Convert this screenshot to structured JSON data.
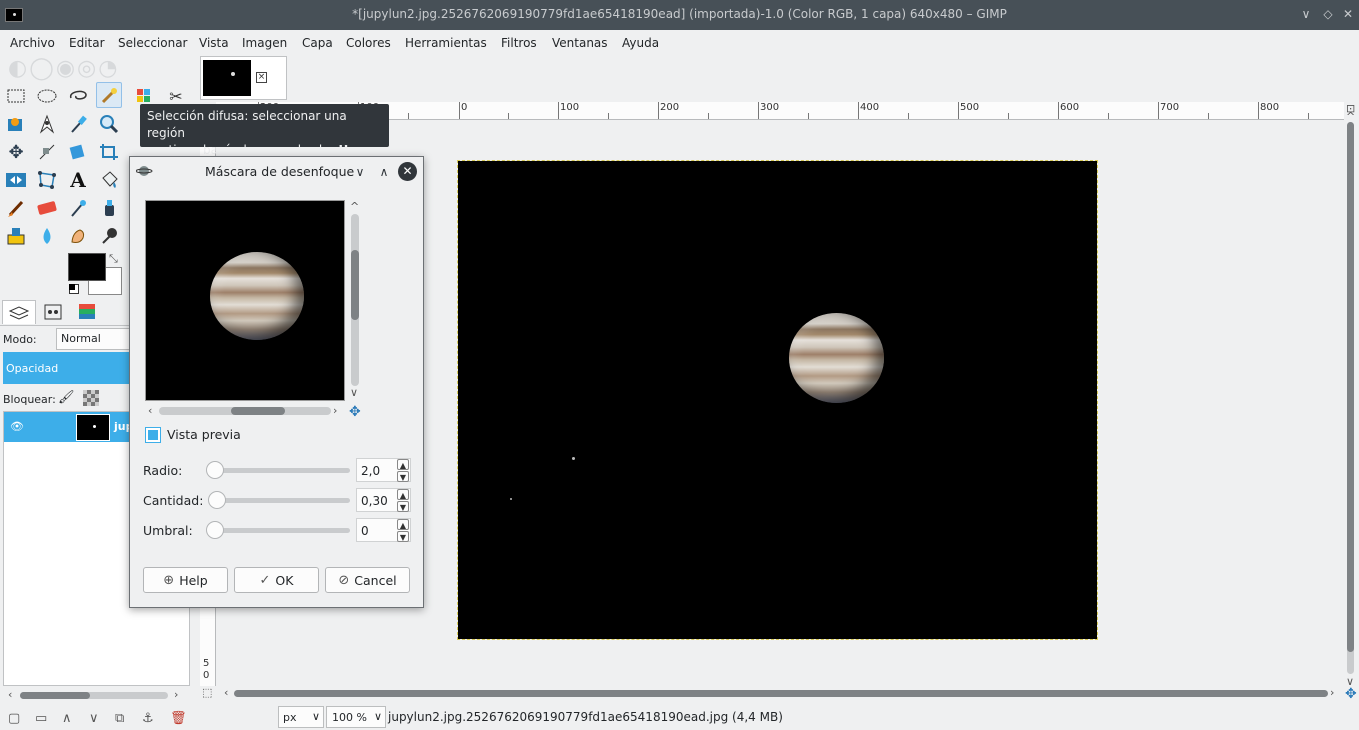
{
  "window": {
    "title": "*[jupylun2.jpg.2526762069190779fd1ae65418190ead] (importada)-1.0 (Color RGB, 1 capa) 640x480 – GIMP",
    "controls": [
      "∨",
      "◇",
      "✕"
    ]
  },
  "menubar": [
    "Archivo",
    "Editar",
    "Seleccionar",
    "Vista",
    "Imagen",
    "Capa",
    "Colores",
    "Herramientas",
    "Filtros",
    "Ventanas",
    "Ayuda"
  ],
  "tooltip": {
    "line1": "Selección difusa: seleccionar una región",
    "line2": "contigua basándose en el color",
    "shortcut": "U"
  },
  "colors": {
    "accent": "#3daee9",
    "titlebar": "#475057",
    "foreground": "#000000",
    "background": "#ffffff"
  },
  "dock": {
    "mode_label": "Modo:",
    "mode_value": "Normal",
    "opacity_label": "Opacidad",
    "lock_label": "Bloquear:",
    "layer_name": "jup"
  },
  "rulers": {
    "horizontal": [
      "200",
      "100",
      "0",
      "100",
      "200",
      "300",
      "400",
      "500",
      "600",
      "700",
      "800"
    ],
    "vertical": [
      "5",
      "0"
    ]
  },
  "statusbar": {
    "unit": "px",
    "zoom": "100 %",
    "info": "jupylun2.jpg.2526762069190779fd1ae65418190ead.jpg (4,4 MB)"
  },
  "dialog": {
    "title": "Máscara de desenfoque",
    "preview_label": "Vista previa",
    "preview_checked": true,
    "params": [
      {
        "label": "Radio:",
        "value": "2,0"
      },
      {
        "label": "Cantidad:",
        "value": "0,30"
      },
      {
        "label": "Umbral:",
        "value": "0"
      }
    ],
    "buttons": {
      "help": "Help",
      "ok": "OK",
      "cancel": "Cancel"
    }
  }
}
